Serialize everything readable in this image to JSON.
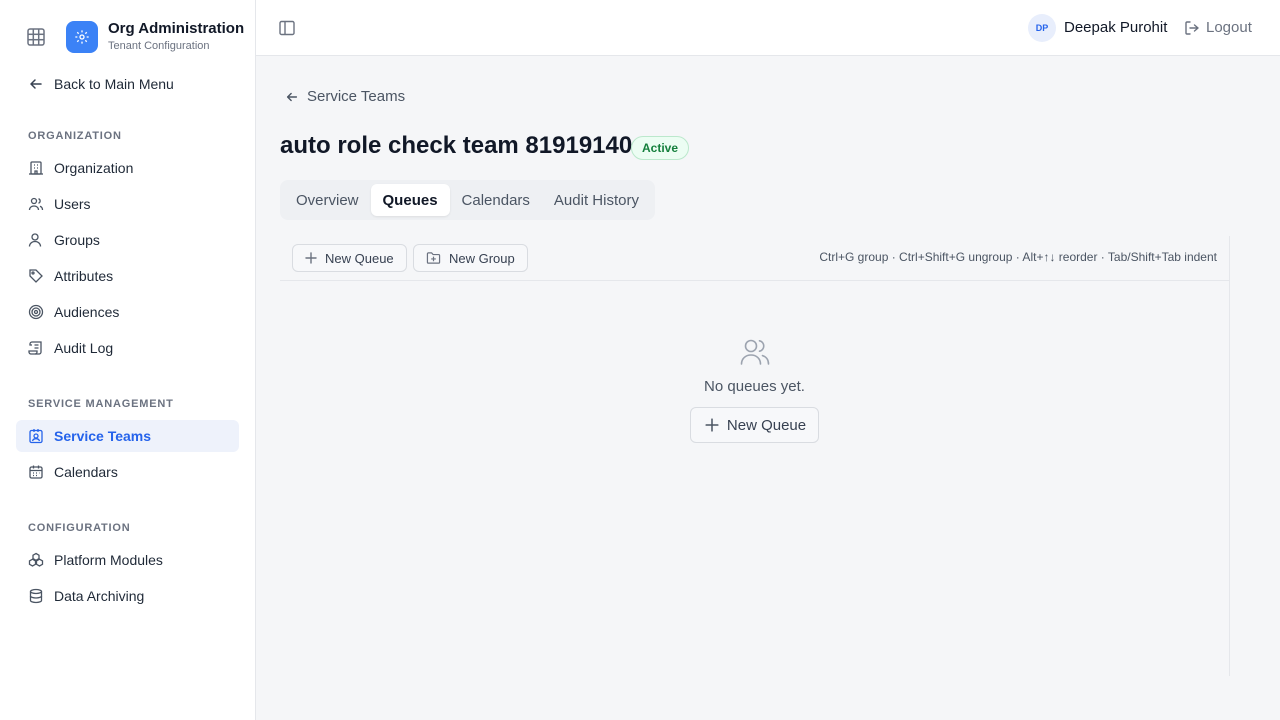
{
  "brand": {
    "title": "Org Administration",
    "subtitle": "Tenant Configuration"
  },
  "sidebar": {
    "back_label": "Back to Main Menu",
    "sections": [
      {
        "label": "ORGANIZATION",
        "items": [
          {
            "label": "Organization",
            "icon": "building-icon"
          },
          {
            "label": "Users",
            "icon": "users-icon"
          },
          {
            "label": "Groups",
            "icon": "group-icon"
          },
          {
            "label": "Attributes",
            "icon": "tag-icon"
          },
          {
            "label": "Audiences",
            "icon": "target-icon"
          },
          {
            "label": "Audit Log",
            "icon": "scroll-icon"
          }
        ]
      },
      {
        "label": "SERVICE MANAGEMENT",
        "items": [
          {
            "label": "Service Teams",
            "icon": "badge-icon",
            "active": true
          },
          {
            "label": "Calendars",
            "icon": "calendar-icon"
          }
        ]
      },
      {
        "label": "CONFIGURATION",
        "items": [
          {
            "label": "Platform Modules",
            "icon": "modules-icon"
          },
          {
            "label": "Data Archiving",
            "icon": "database-icon"
          }
        ]
      }
    ]
  },
  "header": {
    "user_initials": "DP",
    "user_name": "Deepak Purohit",
    "logout_label": "Logout"
  },
  "main": {
    "breadcrumb": "Service Teams",
    "title": "auto role check team 81919140",
    "status": "Active",
    "tabs": [
      {
        "label": "Overview"
      },
      {
        "label": "Queues",
        "active": true
      },
      {
        "label": "Calendars"
      },
      {
        "label": "Audit History"
      }
    ],
    "toolbar": {
      "new_queue_label": "New Queue",
      "new_group_label": "New Group",
      "shortcuts": "Ctrl+G group · Ctrl+Shift+G ungroup · Alt+↑↓ reorder · Tab/Shift+Tab indent"
    },
    "empty": {
      "message": "No queues yet.",
      "button_label": "New Queue"
    }
  },
  "colors": {
    "accent": "#3b82f6",
    "active_nav_bg": "#eef2fb",
    "status_green": "#15803d"
  }
}
